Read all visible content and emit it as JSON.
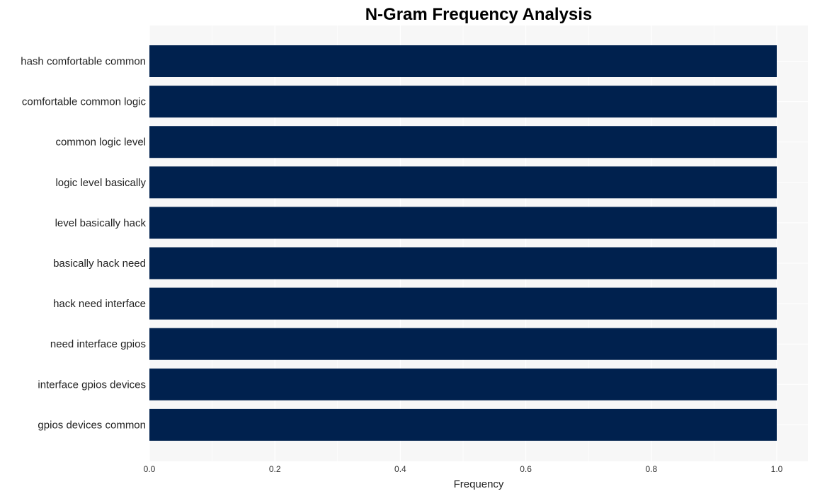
{
  "chart_data": {
    "type": "bar",
    "orientation": "horizontal",
    "title": "N-Gram Frequency Analysis",
    "xlabel": "Frequency",
    "ylabel": "",
    "categories": [
      "hash comfortable common",
      "comfortable common logic",
      "common logic level",
      "logic level basically",
      "level basically hack",
      "basically hack need",
      "hack need interface",
      "need interface gpios",
      "interface gpios devices",
      "gpios devices common"
    ],
    "values": [
      1,
      1,
      1,
      1,
      1,
      1,
      1,
      1,
      1,
      1
    ],
    "xlim": [
      0,
      1.05
    ],
    "xticks": [
      "0.0",
      "0.2",
      "0.4",
      "0.6",
      "0.8",
      "1.0"
    ],
    "grid": true,
    "bar_color": "#00214e",
    "background_color": "#f7f7f7"
  }
}
